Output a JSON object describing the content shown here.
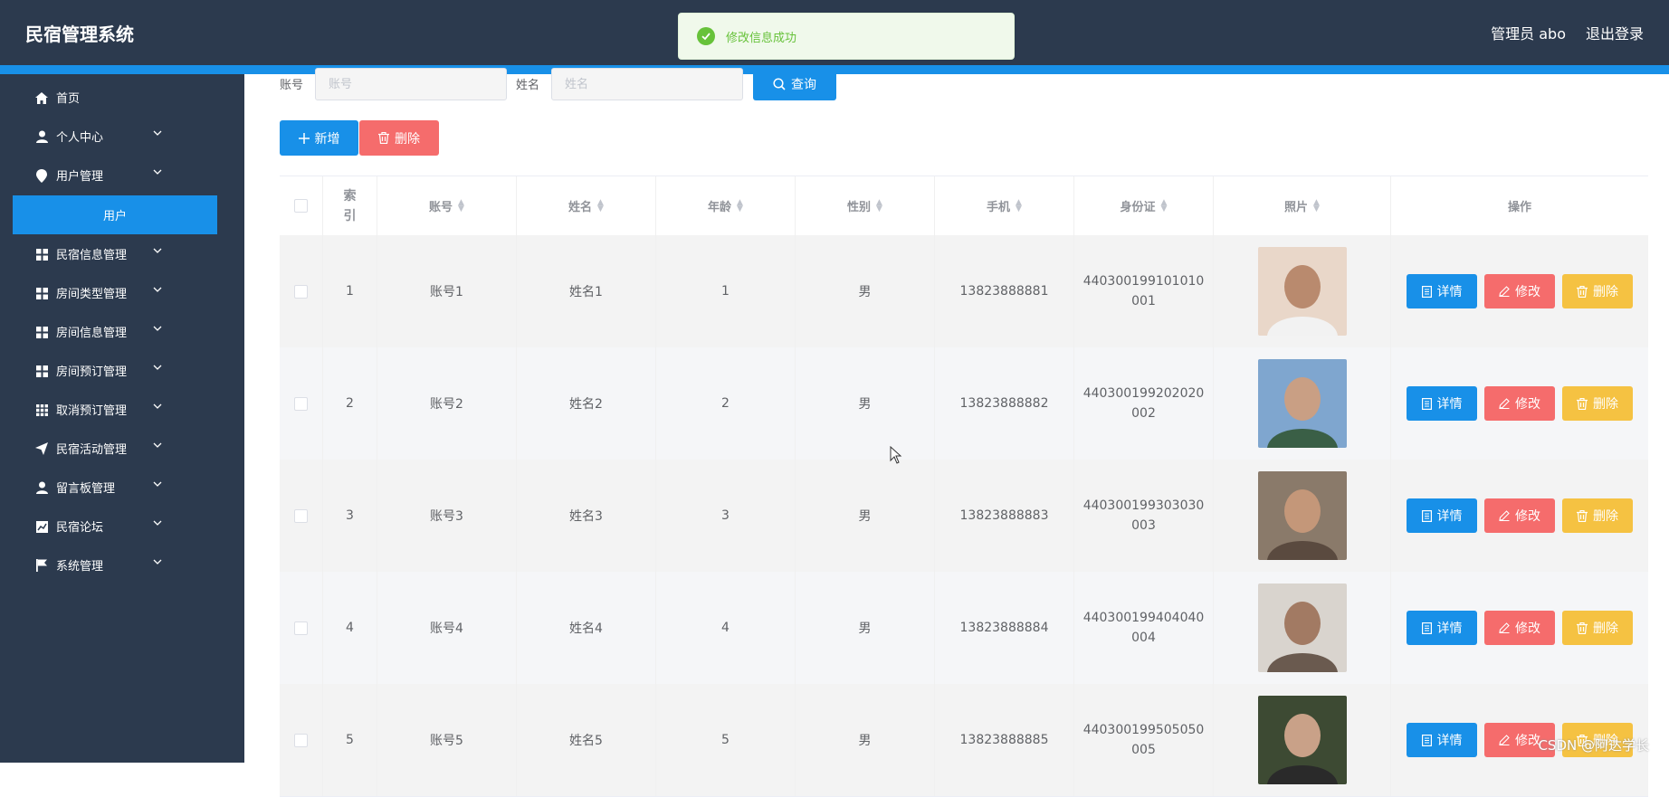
{
  "app": {
    "title": "民宿管理系统",
    "admin_label": "管理员 abo",
    "logout_label": "退出登录"
  },
  "toast": {
    "message": "修改信息成功"
  },
  "sidebar": {
    "items": [
      {
        "label": "首页",
        "icon": "home-icon",
        "has_caret": false
      },
      {
        "label": "个人中心",
        "icon": "user-icon",
        "has_caret": true
      },
      {
        "label": "用户管理",
        "icon": "location-icon",
        "has_caret": true
      },
      {
        "label": "民宿信息管理",
        "icon": "grid-icon",
        "has_caret": true
      },
      {
        "label": "房间类型管理",
        "icon": "grid-icon",
        "has_caret": true
      },
      {
        "label": "房间信息管理",
        "icon": "grid-icon",
        "has_caret": true
      },
      {
        "label": "房间预订管理",
        "icon": "grid-icon",
        "has_caret": true
      },
      {
        "label": "取消预订管理",
        "icon": "apps-icon",
        "has_caret": true
      },
      {
        "label": "民宿活动管理",
        "icon": "send-icon",
        "has_caret": true
      },
      {
        "label": "留言板管理",
        "icon": "user-icon",
        "has_caret": true
      },
      {
        "label": "民宿论坛",
        "icon": "chart-icon",
        "has_caret": true
      },
      {
        "label": "系统管理",
        "icon": "flag-icon",
        "has_caret": true
      }
    ],
    "active_sub": "用户"
  },
  "search": {
    "account_label": "账号",
    "account_placeholder": "账号",
    "name_label": "姓名",
    "name_placeholder": "姓名",
    "query_label": "查询"
  },
  "actions": {
    "add_label": "新增",
    "delete_label": "删除"
  },
  "table": {
    "columns": [
      "索引",
      "账号",
      "姓名",
      "年龄",
      "性别",
      "手机",
      "身份证",
      "照片",
      "操作"
    ],
    "rows": [
      {
        "index": "1",
        "account": "账号1",
        "name": "姓名1",
        "age": "1",
        "gender": "男",
        "phone": "13823888881",
        "id_line1": "440300199101010",
        "id_line2": "001"
      },
      {
        "index": "2",
        "account": "账号2",
        "name": "姓名2",
        "age": "2",
        "gender": "男",
        "phone": "13823888882",
        "id_line1": "440300199202020",
        "id_line2": "002"
      },
      {
        "index": "3",
        "account": "账号3",
        "name": "姓名3",
        "age": "3",
        "gender": "男",
        "phone": "13823888883",
        "id_line1": "440300199303030",
        "id_line2": "003"
      },
      {
        "index": "4",
        "account": "账号4",
        "name": "姓名4",
        "age": "4",
        "gender": "男",
        "phone": "13823888884",
        "id_line1": "440300199404040",
        "id_line2": "004"
      },
      {
        "index": "5",
        "account": "账号5",
        "name": "姓名5",
        "age": "5",
        "gender": "男",
        "phone": "13823888885",
        "id_line1": "440300199505050",
        "id_line2": "005"
      }
    ],
    "ops": {
      "detail": "详情",
      "edit": "修改",
      "delete": "删除"
    }
  },
  "watermark": "CSDN @阿达学长",
  "colors": {
    "primary": "#1890e8",
    "danger": "#f56c6c",
    "warning": "#f5c242",
    "sidebar": "#2c3a4e",
    "success": "#67c23a"
  }
}
